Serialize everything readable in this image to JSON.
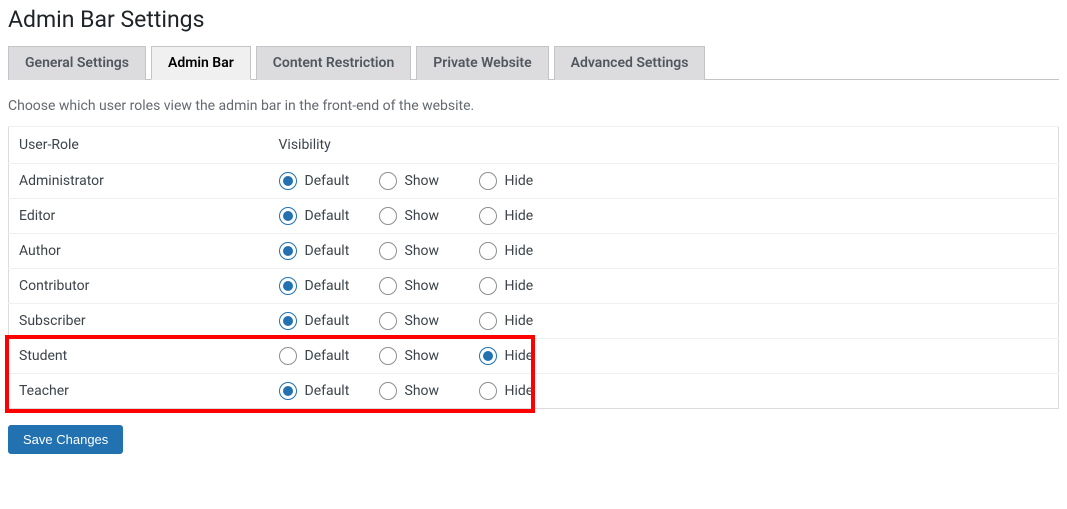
{
  "page_title": "Admin Bar Settings",
  "tabs": [
    {
      "label": "General Settings",
      "active": false
    },
    {
      "label": "Admin Bar",
      "active": true
    },
    {
      "label": "Content Restriction",
      "active": false
    },
    {
      "label": "Private Website",
      "active": false
    },
    {
      "label": "Advanced Settings",
      "active": false
    }
  ],
  "description": "Choose which user roles view the admin bar in the front-end of the website.",
  "table": {
    "header_role": "User-Role",
    "header_visibility": "Visibility",
    "option_labels": {
      "default": "Default",
      "show": "Show",
      "hide": "Hide"
    },
    "rows": [
      {
        "role": "Administrator",
        "selected": "default"
      },
      {
        "role": "Editor",
        "selected": "default"
      },
      {
        "role": "Author",
        "selected": "default"
      },
      {
        "role": "Contributor",
        "selected": "default"
      },
      {
        "role": "Subscriber",
        "selected": "default"
      },
      {
        "role": "Student",
        "selected": "hide"
      },
      {
        "role": "Teacher",
        "selected": "default"
      }
    ]
  },
  "highlight": {
    "row_start_index": 5,
    "row_end_index": 6
  },
  "save_button": "Save Changes"
}
